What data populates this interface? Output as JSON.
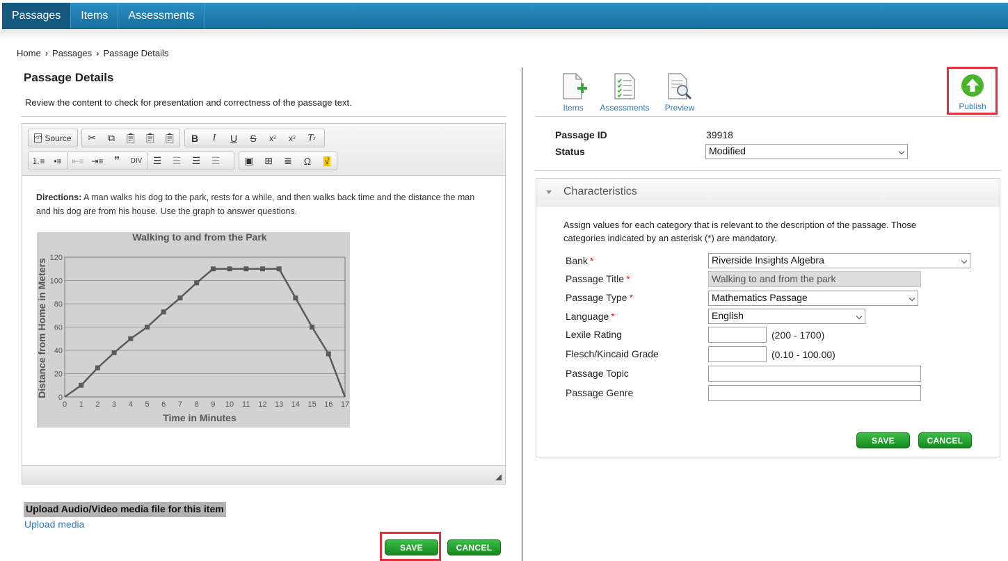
{
  "nav": {
    "tabs": [
      {
        "label": "Passages"
      },
      {
        "label": "Items"
      },
      {
        "label": "Assessments"
      }
    ]
  },
  "breadcrumb": [
    "Home",
    "Passages",
    "Passage Details"
  ],
  "breadcrumb_sep": "›",
  "left": {
    "title": "Passage Details",
    "description": "Review the content to check for presentation and correctness of the passage text.",
    "toolbar": {
      "source_label": "Source"
    },
    "content": {
      "directions_label": "Directions:",
      "directions_text": " A man walks his dog to the park, rests for a while, and then walks back time and the distance the man and his dog are from his house. Use the graph to answer questions."
    },
    "upload_heading": "Upload Audio/Video media file for this item",
    "upload_link": "Upload media",
    "save_label": "SAVE",
    "cancel_label": "CANCEL"
  },
  "chart_data": {
    "type": "line",
    "title": "Walking to and from the Park",
    "xlabel": "Time in Minutes",
    "ylabel": "Distance from Home in Meters",
    "x": [
      0,
      1,
      2,
      3,
      4,
      5,
      6,
      7,
      8,
      9,
      10,
      11,
      12,
      13,
      14,
      15,
      16,
      17
    ],
    "y": [
      0,
      10,
      25,
      38,
      50,
      60,
      73,
      85,
      98,
      110,
      110,
      110,
      110,
      110,
      85,
      60,
      37,
      0
    ],
    "xlim": [
      0,
      17
    ],
    "ylim": [
      0,
      120
    ],
    "yticks": [
      0,
      20,
      40,
      60,
      80,
      100,
      120
    ],
    "xticks": [
      0,
      1,
      2,
      3,
      4,
      5,
      6,
      7,
      8,
      9,
      10,
      11,
      12,
      13,
      14,
      15,
      16,
      17
    ],
    "grid": true,
    "colors": {
      "background": "#d2d2d2",
      "line": "#5a5a5a",
      "text": "#555555"
    }
  },
  "right": {
    "actions": [
      {
        "label": "Items",
        "icon": "document-add-icon"
      },
      {
        "label": "Assessments",
        "icon": "checklist-icon"
      },
      {
        "label": "Preview",
        "icon": "preview-magnifier-icon"
      }
    ],
    "publish_label": "Publish",
    "passage_id_label": "Passage ID",
    "passage_id": "39918",
    "status_label": "Status",
    "status_value": "Modified",
    "characteristics": {
      "title": "Characteristics",
      "description": "Assign values for each category that is relevant to the description of the passage. Those categories indicated by an asterisk (*) are mandatory.",
      "fields": {
        "bank": {
          "label": "Bank",
          "value": "Riverside Insights Algebra"
        },
        "title": {
          "label": "Passage Title",
          "value": "Walking to and from the park"
        },
        "type": {
          "label": "Passage Type",
          "value": "Mathematics Passage"
        },
        "language": {
          "label": "Language",
          "value": "English"
        },
        "lexile": {
          "label": "Lexile Rating",
          "value": "",
          "range": "(200 - 1700)"
        },
        "flesch": {
          "label": "Flesch/Kincaid Grade",
          "value": "",
          "range": "(0.10 - 100.00)"
        },
        "topic": {
          "label": "Passage Topic",
          "value": ""
        },
        "genre": {
          "label": "Passage Genre",
          "value": ""
        }
      },
      "required_mark": "*",
      "save_label": "SAVE",
      "cancel_label": "CANCEL"
    }
  },
  "colors": {
    "nav": "#1f7db3",
    "accent_link": "#2e7bbf",
    "button_green": "#1e9a29",
    "highlight_red": "#e3313c",
    "publish_green": "#49b42b"
  }
}
